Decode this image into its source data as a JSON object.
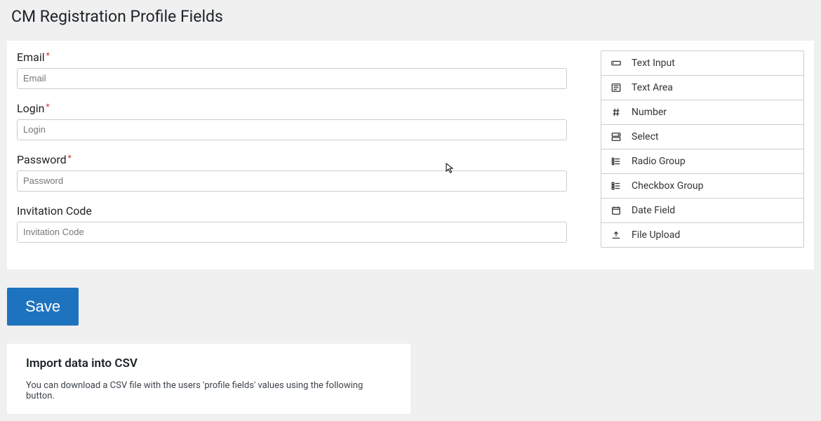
{
  "page": {
    "title": "CM Registration Profile Fields"
  },
  "form_fields": [
    {
      "label": "Email",
      "placeholder": "Email",
      "required": true
    },
    {
      "label": "Login",
      "placeholder": "Login",
      "required": true
    },
    {
      "label": "Password",
      "placeholder": "Password",
      "required": true
    },
    {
      "label": "Invitation Code",
      "placeholder": "Invitation Code",
      "required": false
    }
  ],
  "field_types": [
    {
      "icon": "text-input",
      "label": "Text Input"
    },
    {
      "icon": "text-area",
      "label": "Text Area"
    },
    {
      "icon": "number",
      "label": "Number"
    },
    {
      "icon": "select",
      "label": "Select"
    },
    {
      "icon": "radio-group",
      "label": "Radio Group"
    },
    {
      "icon": "checkbox-group",
      "label": "Checkbox Group"
    },
    {
      "icon": "date",
      "label": "Date Field"
    },
    {
      "icon": "upload",
      "label": "File Upload"
    }
  ],
  "actions": {
    "save_label": "Save"
  },
  "import": {
    "title": "Import data into CSV",
    "desc": "You can download a CSV file with the users 'profile fields' values using the following button."
  }
}
